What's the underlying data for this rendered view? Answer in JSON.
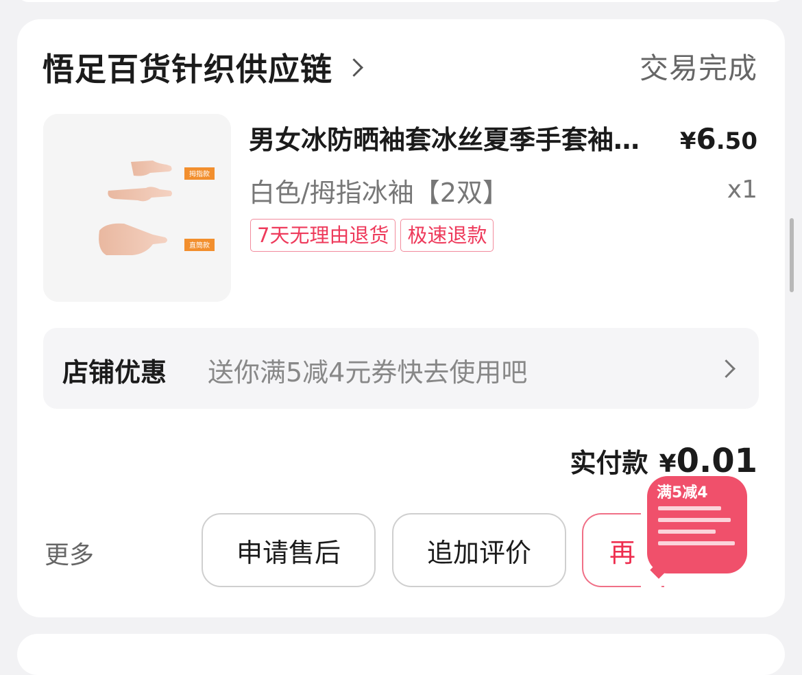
{
  "shop": {
    "name": "悟足百货针织供应链",
    "status": "交易完成"
  },
  "product": {
    "title": "男女冰防晒袖套冰丝夏季手套袖防紫外线",
    "price_currency": "¥",
    "price_int": "6",
    "price_dec": ".50",
    "spec": "白色/拇指冰袖【2双】",
    "qty": "x1",
    "image_labels": [
      "拇指款",
      "直筒款"
    ],
    "tags": [
      "7天无理由退货",
      "极速退款"
    ]
  },
  "promo": {
    "label": "店铺优惠",
    "text": "送你满5减4元券快去使用吧"
  },
  "payment": {
    "label": "实付款",
    "currency": "¥",
    "amount": "0.01"
  },
  "actions": {
    "more": "更多",
    "after_sale": "申请售后",
    "add_review": "追加评价",
    "rebuy": "再"
  },
  "floating_coupon": {
    "text": "满5减4"
  },
  "colors": {
    "accent": "#ee2e4f",
    "tag_border": "#f28b9c",
    "coupon_bg": "#f0506b"
  }
}
